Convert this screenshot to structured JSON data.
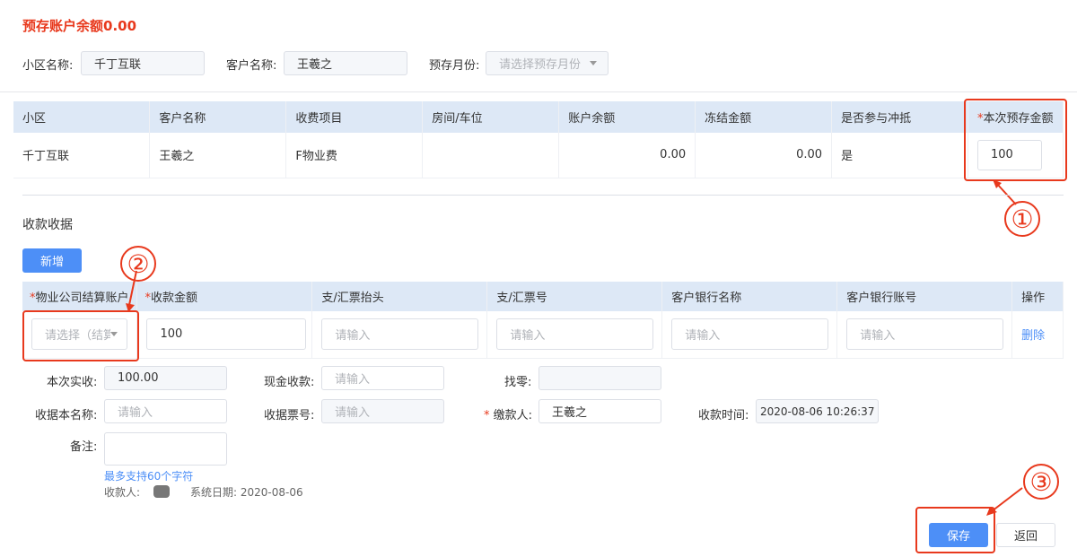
{
  "header": {
    "title": "预存账户余额0.00"
  },
  "filters": {
    "community_label": "小区名称:",
    "community_value": "千丁互联",
    "customer_label": "客户名称:",
    "customer_value": "王羲之",
    "month_label": "预存月份:",
    "month_placeholder": "请选择预存月份"
  },
  "table1": {
    "headers": [
      "小区",
      "客户名称",
      "收费项目",
      "房间/车位",
      "账户余额",
      "冻结金额",
      "是否参与冲抵",
      "本次预存金额"
    ],
    "required_star": "*",
    "row": {
      "community": "千丁互联",
      "customer": "王羲之",
      "item": "F物业费",
      "room": "",
      "balance": "0.00",
      "frozen": "0.00",
      "offset": "是",
      "amount": "100"
    }
  },
  "section": {
    "title": "收款收据",
    "add_button": "新增"
  },
  "table2": {
    "headers": [
      "物业公司结算账户",
      "收款金额",
      "支/汇票抬头",
      "支/汇票号",
      "客户银行名称",
      "客户银行账号",
      "操作"
    ],
    "row": {
      "account_placeholder": "请选择（结算",
      "amount": "100",
      "input_placeholder": "请输入",
      "delete": "删除"
    }
  },
  "form": {
    "actual_label": "本次实收:",
    "actual_value": "100.00",
    "cash_label": "现金收款:",
    "cash_placeholder": "请输入",
    "change_label": "找零:",
    "receipt_name_label": "收据本名称:",
    "receipt_name_placeholder": "请输入",
    "receipt_no_label": "收据票号:",
    "receipt_no_placeholder": "请输入",
    "payer_label": "缴款人:",
    "payer_value": "王羲之",
    "time_label": "收款时间:",
    "time_value": "2020-08-06 10:26:37",
    "remark_label": "备注:",
    "remark_hint": "最多支持60个字符",
    "collector_label": "收款人:",
    "system_date": "系统日期: 2020-08-06"
  },
  "footer": {
    "save": "保存",
    "back": "返回"
  },
  "annotations": {
    "one": "①",
    "two": "②",
    "three": "③"
  },
  "colors": {
    "accent": "#4d8ff7",
    "red": "#e8391d",
    "header_bg": "#dde8f6"
  }
}
